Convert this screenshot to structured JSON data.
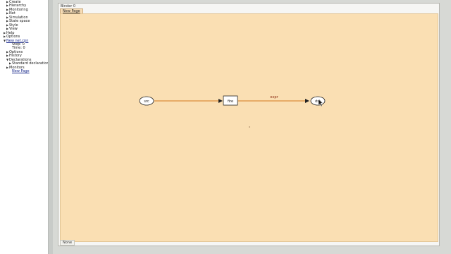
{
  "sidebar": {
    "items": [
      {
        "label": "Create",
        "indent": 1,
        "arrow": "▶",
        "link": false
      },
      {
        "label": "Hierarchy",
        "indent": 1,
        "arrow": "▶",
        "link": false
      },
      {
        "label": "Monitoring",
        "indent": 1,
        "arrow": "▶",
        "link": false
      },
      {
        "label": "Net",
        "indent": 1,
        "arrow": "▶",
        "link": false
      },
      {
        "label": "Simulation",
        "indent": 1,
        "arrow": "▶",
        "link": false
      },
      {
        "label": "State space",
        "indent": 1,
        "arrow": "▶",
        "link": false
      },
      {
        "label": "Style",
        "indent": 1,
        "arrow": "▶",
        "link": false
      },
      {
        "label": "View",
        "indent": 1,
        "arrow": "▶",
        "link": false
      },
      {
        "label": "Help",
        "indent": 0,
        "arrow": "▶",
        "link": false
      },
      {
        "label": "Options",
        "indent": 0,
        "arrow": "▶",
        "link": false
      },
      {
        "label": "New net.cpn",
        "indent": 0,
        "arrow": "▼",
        "link": true
      },
      {
        "label": "Step: 0",
        "indent": 2,
        "arrow": "",
        "link": false
      },
      {
        "label": "Time: 0",
        "indent": 2,
        "arrow": "",
        "link": false
      },
      {
        "label": "Options",
        "indent": 1,
        "arrow": "▶",
        "link": false
      },
      {
        "label": "History",
        "indent": 1,
        "arrow": "▶",
        "link": false
      },
      {
        "label": "Declarations",
        "indent": 1,
        "arrow": "▼",
        "link": false
      },
      {
        "label": "Standard declarations",
        "indent": 2,
        "arrow": "▶",
        "link": false
      },
      {
        "label": "Monitors",
        "indent": 1,
        "arrow": "▶",
        "link": false
      },
      {
        "label": "New Page",
        "indent": 2,
        "arrow": "",
        "link": true
      }
    ]
  },
  "binder": {
    "title": "Binder 0",
    "tab_label": "New Page",
    "status_label": "None"
  },
  "net": {
    "place_src": "src",
    "transition": "fire",
    "place_dst": "dst",
    "arc_label": "expr"
  },
  "colors": {
    "canvas": "#fadfb3",
    "arc": "#d4781c",
    "sidebar_bg": "#ffffff",
    "desktop": "#d7d9d5"
  }
}
